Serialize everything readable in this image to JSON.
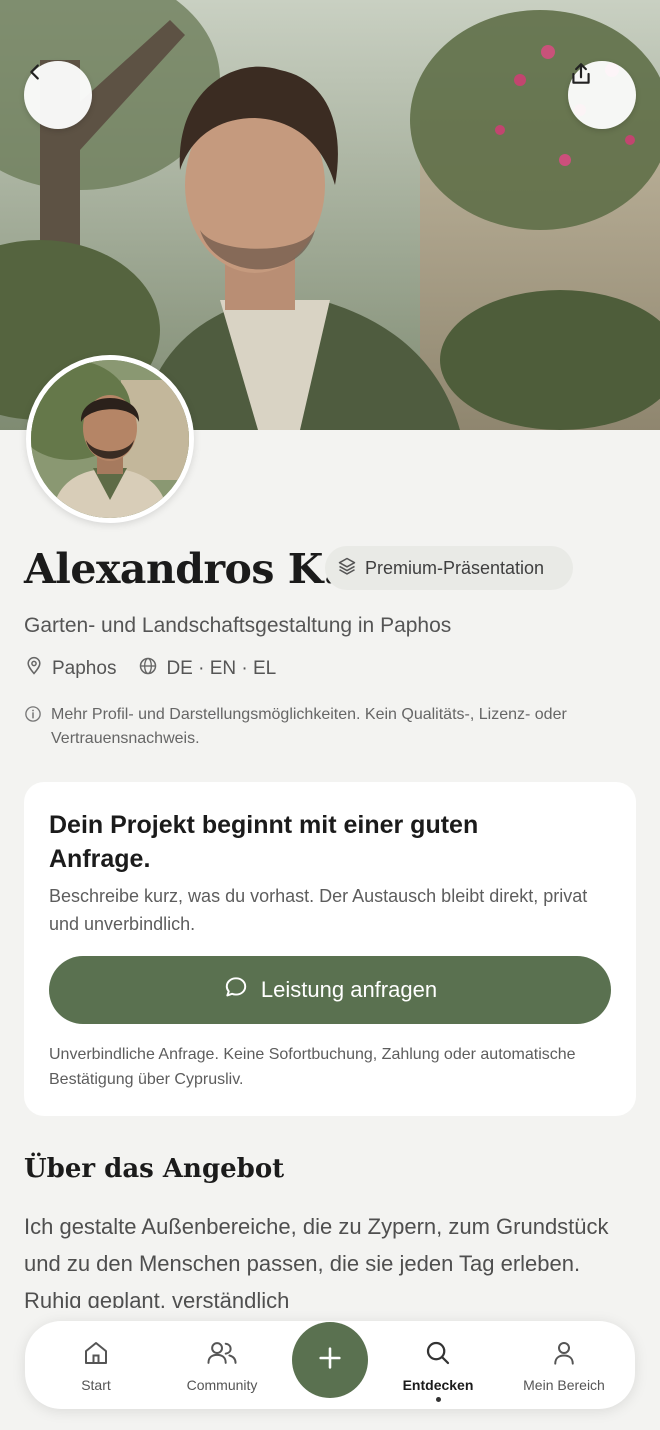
{
  "profile": {
    "name": "Alexandros K.",
    "badge": "Premium-Präsentation",
    "subtitle": "Garten- und Landschaftsgestaltung in Paphos",
    "location": "Paphos",
    "languages": "DE · EN · EL",
    "notice": "Mehr Profil- und Darstellungsmöglichkeiten. Kein Qualitäts-, Lizenz- oder Vertrauensnachweis."
  },
  "card": {
    "title": "Dein Projekt beginnt mit einer guten Anfrage.",
    "text": "Beschreibe kurz, was du vorhast. Der Austausch bleibt direkt, privat und unverbindlich.",
    "cta_label": "Leistung anfragen",
    "footnote": "Unverbindliche Anfrage. Keine Sofortbuchung, Zahlung oder automatische Bestätigung über Cyprusliv."
  },
  "about": {
    "heading": "Über das Angebot",
    "text": "Ich gestalte Außenbereiche, die zu Zypern, zum Grundstück und zu den Menschen passen, die sie jeden Tag erleben. Ruhig geplant, verständlich"
  },
  "nav": {
    "items": [
      {
        "label": "Start",
        "icon": "home-icon"
      },
      {
        "label": "Community",
        "icon": "people-icon"
      },
      {
        "label": "Entdecken",
        "icon": "search-icon",
        "active": true
      },
      {
        "label": "Mein Bereich",
        "icon": "user-icon"
      }
    ],
    "fab_icon": "plus-icon"
  },
  "colors": {
    "accent": "#5a7150",
    "background": "#f3f3f1",
    "card": "#ffffff"
  }
}
